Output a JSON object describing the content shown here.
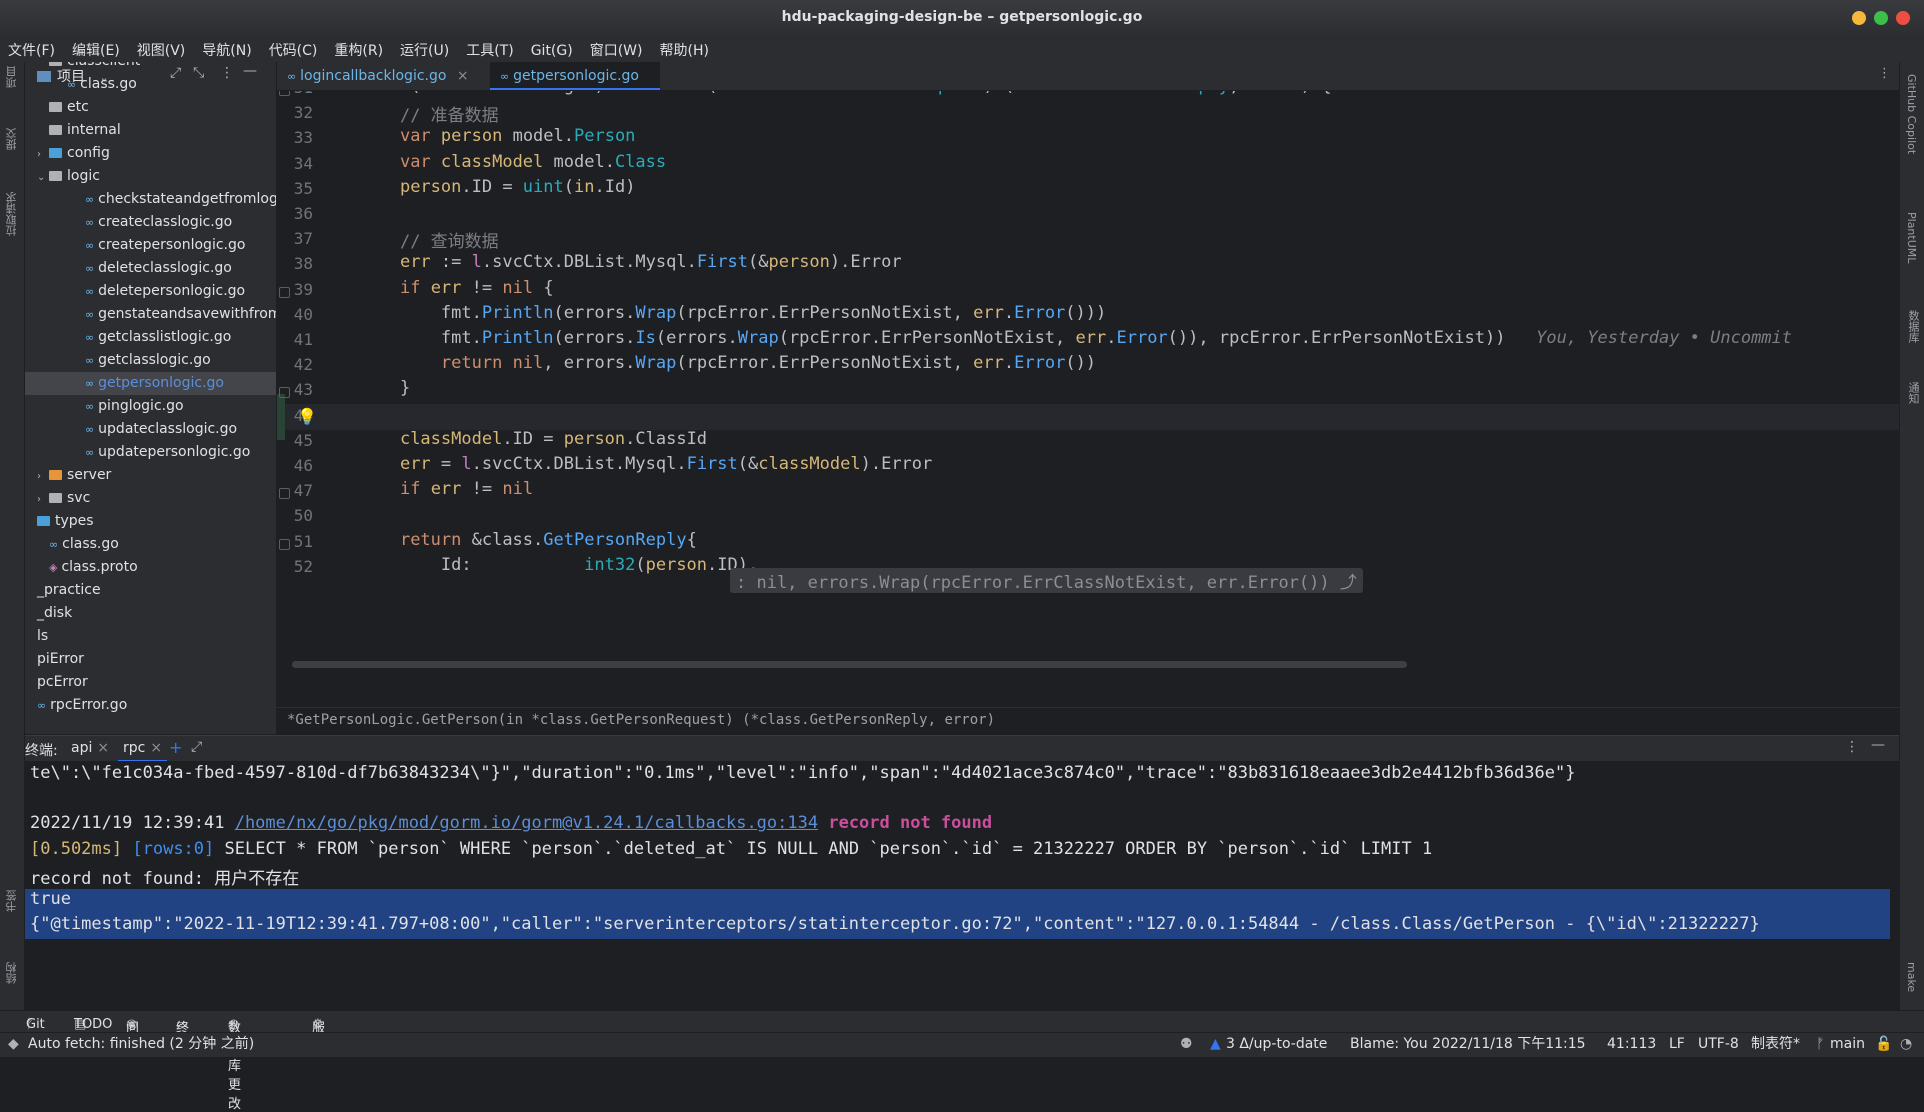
{
  "window": {
    "title": "hdu-packaging-design-be – getpersonlogic.go"
  },
  "menu": [
    "文件(F)",
    "编辑(E)",
    "视图(V)",
    "导航(N)",
    "代码(C)",
    "重构(R)",
    "运行(U)",
    "工具(T)",
    "Git(G)",
    "窗口(W)",
    "帮助(H)"
  ],
  "left_strip": {
    "project": "项目",
    "commit": "提交",
    "pull_requests": "拉取请求",
    "bookmarks": "书签",
    "structure": "结构"
  },
  "right_strip": {
    "copilot": "GitHub Copilot",
    "plantuml": "PlantUML",
    "database": "数据库",
    "notifications": "通知",
    "make": "make"
  },
  "project_panel": {
    "title": "项目",
    "tree": [
      {
        "label": "classclient",
        "type": "folder",
        "indent": 1,
        "arrow": ""
      },
      {
        "label": "class.go",
        "type": "go",
        "indent": 2,
        "arrow": ""
      },
      {
        "label": "etc",
        "type": "folder",
        "indent": 1,
        "arrow": ""
      },
      {
        "label": "internal",
        "type": "folder",
        "indent": 1,
        "arrow": ""
      },
      {
        "label": "config",
        "type": "folder-blue",
        "indent": 1,
        "arrow": "›"
      },
      {
        "label": "logic",
        "type": "folder",
        "indent": 1,
        "arrow": "⌄"
      },
      {
        "label": "checkstateandgetfromlog",
        "type": "go",
        "indent": 3,
        "arrow": ""
      },
      {
        "label": "createclasslogic.go",
        "type": "go",
        "indent": 3,
        "arrow": ""
      },
      {
        "label": "createpersonlogic.go",
        "type": "go",
        "indent": 3,
        "arrow": ""
      },
      {
        "label": "deleteclasslogic.go",
        "type": "go",
        "indent": 3,
        "arrow": ""
      },
      {
        "label": "deletepersonlogic.go",
        "type": "go",
        "indent": 3,
        "arrow": ""
      },
      {
        "label": "genstateandsavewithfrom",
        "type": "go",
        "indent": 3,
        "arrow": ""
      },
      {
        "label": "getclasslistlogic.go",
        "type": "go",
        "indent": 3,
        "arrow": ""
      },
      {
        "label": "getclasslogic.go",
        "type": "go",
        "indent": 3,
        "arrow": ""
      },
      {
        "label": "getpersonlogic.go",
        "type": "go",
        "indent": 3,
        "arrow": "",
        "selected": true
      },
      {
        "label": "pinglogic.go",
        "type": "go",
        "indent": 3,
        "arrow": ""
      },
      {
        "label": "updateclasslogic.go",
        "type": "go",
        "indent": 3,
        "arrow": ""
      },
      {
        "label": "updatepersonlogic.go",
        "type": "go",
        "indent": 3,
        "arrow": ""
      },
      {
        "label": "server",
        "type": "folder-orange",
        "indent": 1,
        "arrow": "›"
      },
      {
        "label": "svc",
        "type": "folder",
        "indent": 1,
        "arrow": "›"
      },
      {
        "label": "types",
        "type": "folder-blue",
        "indent": 0,
        "arrow": ""
      },
      {
        "label": "class.go",
        "type": "go",
        "indent": 1,
        "arrow": ""
      },
      {
        "label": "class.proto",
        "type": "proto",
        "indent": 1,
        "arrow": ""
      },
      {
        "label": "_practice",
        "type": "none",
        "indent": 0,
        "arrow": ""
      },
      {
        "label": "_disk",
        "type": "none",
        "indent": 0,
        "arrow": ""
      },
      {
        "label": "ls",
        "type": "none",
        "indent": 0,
        "arrow": ""
      },
      {
        "label": "piError",
        "type": "none",
        "indent": 0,
        "arrow": ""
      },
      {
        "label": "pcError",
        "type": "none",
        "indent": 0,
        "arrow": ""
      },
      {
        "label": "rpcError.go",
        "type": "go",
        "indent": 0,
        "arrow": ""
      }
    ]
  },
  "tabs": [
    {
      "label": "logincallbacklogic.go",
      "active": false
    },
    {
      "label": "getpersonlogic.go",
      "active": true
    }
  ],
  "editor": {
    "lines": [
      {
        "num": "31",
        "html": "<span class=\"k\">func</span> (<span class=\"rcv\">l</span> *<span class=\"tp\">GetPersonLogic</span>) <span class=\"f\">GetPerson</span>(<span class=\"pn\">in</span> *class.<span class=\"t\">GetPersonRequest</span>) (*class.<span class=\"t\">GetPersonReply</span>, <span class=\"k\">error</span>) {"
      },
      {
        "num": "32",
        "html": "    <span class=\"cmt\">// 准备数据</span>"
      },
      {
        "num": "33",
        "html": "    <span class=\"k\">var</span> <span class=\"pn\">person</span> model.<span class=\"t\">Person</span>"
      },
      {
        "num": "34",
        "html": "    <span class=\"k\">var</span> <span class=\"pn\">classModel</span> model.<span class=\"t\">Class</span>"
      },
      {
        "num": "35",
        "html": "    <span class=\"pn\">person</span>.ID = <span class=\"t\">uint</span>(<span class=\"pn\">in</span>.Id)"
      },
      {
        "num": "36",
        "html": ""
      },
      {
        "num": "37",
        "html": "    <span class=\"cmt\">// 查询数据</span>"
      },
      {
        "num": "38",
        "html": "    <span class=\"pn\">err</span> := <span class=\"rcv\">l</span>.svcCtx.DBList.Mysql.<span class=\"f\">First</span>(&amp;<span class=\"pn\">person</span>).Error"
      },
      {
        "num": "39",
        "html": "    <span class=\"k\">if</span> <span class=\"pn\">err</span> != <span class=\"k\">nil</span> {"
      },
      {
        "num": "40",
        "html": "        fmt.<span class=\"f\">Println</span>(errors.<span class=\"f\">Wrap</span>(rpcError.ErrPersonNotExist, <span class=\"pn\">err</span>.<span class=\"f\">Error</span>()))"
      },
      {
        "num": "41",
        "html": "        fmt.<span class=\"f\">Println</span>(errors.<span class=\"f\">Is</span>(errors.<span class=\"f\">Wrap</span>(rpcError.ErrPersonNotExist, <span class=\"pn\">err</span>.<span class=\"f\">Error</span>()), rpcError.ErrPersonNotExist))   <span class=\"c\" style=\"font-style:italic\">You, Yesterday • Uncommit</span>"
      },
      {
        "num": "42",
        "html": "        <span class=\"k\">return</span> <span class=\"k\">nil</span>, errors.<span class=\"f\">Wrap</span>(rpcError.ErrPersonNotExist, <span class=\"pn\">err</span>.<span class=\"f\">Error</span>())"
      },
      {
        "num": "43",
        "html": "    }"
      },
      {
        "num": "44",
        "html": ""
      },
      {
        "num": "45",
        "html": "    <span class=\"pn\">classModel</span>.ID = <span class=\"pn\">person</span>.ClassId"
      },
      {
        "num": "46",
        "html": "    <span class=\"pn\">err</span> = <span class=\"rcv\">l</span>.svcCtx.DBList.Mysql.<span class=\"f\">First</span>(&amp;<span class=\"pn\">classModel</span>).Error"
      },
      {
        "num": "47",
        "html": "    <span class=\"k\">if</span> <span class=\"pn\">err</span> != <span class=\"k\">nil</span> "
      },
      {
        "num": "50",
        "html": ""
      },
      {
        "num": "51",
        "html": "    <span class=\"k\">return</span> &amp;class.<span class=\"f\">GetPersonReply</span>{"
      },
      {
        "num": "52",
        "html": "        Id:           <span class=\"t\">int32</span>(<span class=\"pn\">person</span>.ID),"
      }
    ],
    "fold_text": ": nil, errors.Wrap(rpcError.ErrClassNotExist, err.Error()) ⤴",
    "breadcrumb": "*GetPersonLogic.GetPerson(in *class.GetPersonRequest) (*class.GetPersonReply, error)"
  },
  "terminal": {
    "label": "终端:",
    "tabs": [
      "api",
      "rpc"
    ],
    "lines": [
      {
        "html": "te\\\":\\\"fe1c034a-fbed-4597-810d-df7b63843234\\\"}\",\"duration\":\"0.1ms\",\"level\":\"info\",\"span\":\"4d4021ace3c874c0\",\"trace\":\"83b831618eaaee3db2e4412bfb36d36e\"}"
      },
      {
        "html": ""
      },
      {
        "html": "2022/11/19 12:39:41 <span style=\"color:#5c8ed8;text-decoration:underline\">/home/nx/go/pkg/mod/gorm.io/gorm@v1.24.1/callbacks.go:134</span> <span style=\"color:#c94f9d;font-weight:bold\">record not found</span>"
      },
      {
        "html": "<span style=\"color:#d5b778\">[0.502ms]</span> <span style=\"color:#3d8ef0\">[rows:0]</span> SELECT * FROM `person` WHERE `person`.`deleted_at` IS NULL AND `person`.`id` = 21322227 ORDER BY `person`.`id` LIMIT 1"
      },
      {
        "html": "record not found: 用户不存在"
      },
      {
        "html": "true"
      },
      {
        "html": "{\"@timestamp\":\"2022-11-19T12:39:41.797+08:00\",\"caller\":\"serverinterceptors/statinterceptor.go:72\",\"content\":\"127.0.0.1:54844 - /class.Class/GetPerson - {\\\"id\\\":21322227}"
      }
    ]
  },
  "bottom_tools": [
    "Git",
    "TODO",
    "问题",
    "终端",
    "数据库更改",
    "服务"
  ],
  "status": {
    "left": "Auto fetch: finished (2 分钟 之前)",
    "vcs": "3 Δ/up-to-date",
    "blame": "Blame: You 2022/11/18 下午11:15",
    "position": "41:113",
    "line_sep": "LF",
    "encoding": "UTF-8",
    "indent": "制表符*",
    "branch": "main"
  }
}
